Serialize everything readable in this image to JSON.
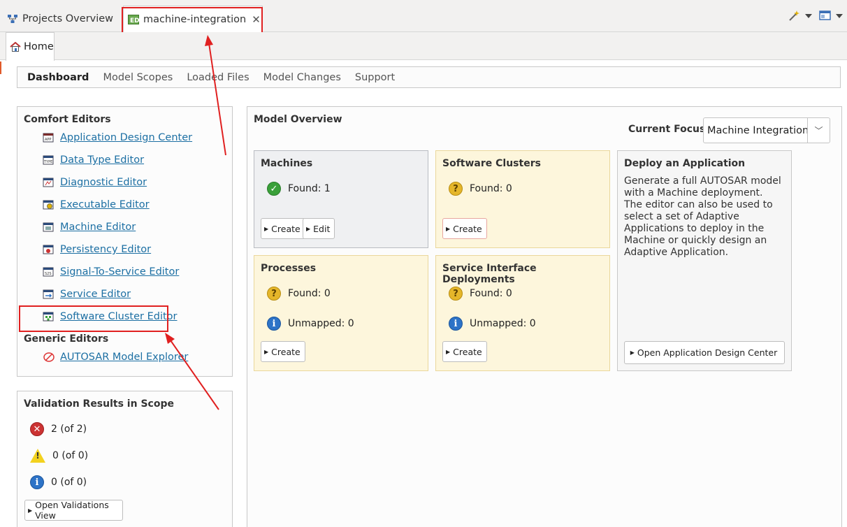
{
  "top_tabs": [
    {
      "label": "Projects Overview"
    },
    {
      "label": "machine-integration"
    }
  ],
  "home_tab": {
    "label": "Home"
  },
  "page_nav": [
    "Dashboard",
    "Model Scopes",
    "Loaded Files",
    "Model Changes",
    "Support"
  ],
  "comfort_editors": {
    "title": "Comfort Editors",
    "items": [
      "Application Design Center",
      "Data Type Editor",
      "Diagnostic Editor",
      "Executable Editor",
      "Machine Editor",
      "Persistency Editor",
      "Signal-To-Service Editor",
      "Service Editor",
      "Software Cluster Editor"
    ],
    "generic_title": "Generic Editors",
    "generic_items": [
      "AUTOSAR Model Explorer"
    ]
  },
  "validation": {
    "title": "Validation Results in Scope",
    "errors": "2 (of 2)",
    "warnings": "0 (of 0)",
    "infos": "0 (of 0)",
    "button": "Open Validations View"
  },
  "model_overview": {
    "title": "Model Overview",
    "focus_label": "Current Focus:",
    "focus_value": "Machine Integration",
    "cards": {
      "machines": {
        "title": "Machines",
        "found": "Found: 1",
        "create": "Create",
        "edit": "Edit"
      },
      "software_clusters": {
        "title": "Software Clusters",
        "found": "Found: 0",
        "create": "Create"
      },
      "processes": {
        "title": "Processes",
        "found": "Found: 0",
        "unmapped": "Unmapped: 0",
        "create": "Create"
      },
      "service_interface_deployments": {
        "title": "Service Interface Deployments",
        "found": "Found: 0",
        "unmapped": "Unmapped: 0",
        "create": "Create"
      },
      "deploy": {
        "title": "Deploy an Application",
        "lines": [
          "Generate a full AUTOSAR model",
          "with a Machine deployment.",
          "The editor can also be used to",
          "select a set of Adaptive",
          "Applications to deploy in the",
          "Machine or quickly design an",
          "Adaptive Application."
        ],
        "button": "Open Application Design Center"
      }
    }
  },
  "colors": {
    "link": "#1c6fa3",
    "annotation_red": "#e02020",
    "warn_card": "#fdf6dc"
  }
}
